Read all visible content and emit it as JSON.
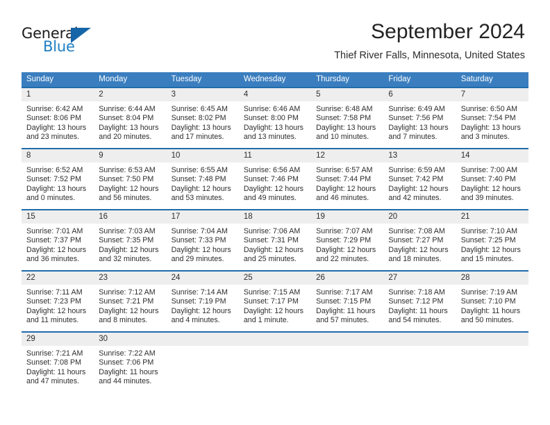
{
  "logo": {
    "text_general": "General",
    "text_blue": "Blue",
    "triangle_color": "#1565a8",
    "blue_color": "#1f7fc4"
  },
  "header": {
    "month_title": "September 2024",
    "location": "Thief River Falls, Minnesota, United States"
  },
  "theme": {
    "header_row_bg": "#3a7ebf",
    "week_separator": "#1f6cab",
    "day_band_bg": "#eeeeee",
    "text": "#2d2d2d"
  },
  "weekdays": [
    "Sunday",
    "Monday",
    "Tuesday",
    "Wednesday",
    "Thursday",
    "Friday",
    "Saturday"
  ],
  "weeks": [
    [
      {
        "day": "1",
        "sunrise": "Sunrise: 6:42 AM",
        "sunset": "Sunset: 8:06 PM",
        "daylight_line1": "Daylight: 13 hours",
        "daylight_line2": "and 23 minutes."
      },
      {
        "day": "2",
        "sunrise": "Sunrise: 6:44 AM",
        "sunset": "Sunset: 8:04 PM",
        "daylight_line1": "Daylight: 13 hours",
        "daylight_line2": "and 20 minutes."
      },
      {
        "day": "3",
        "sunrise": "Sunrise: 6:45 AM",
        "sunset": "Sunset: 8:02 PM",
        "daylight_line1": "Daylight: 13 hours",
        "daylight_line2": "and 17 minutes."
      },
      {
        "day": "4",
        "sunrise": "Sunrise: 6:46 AM",
        "sunset": "Sunset: 8:00 PM",
        "daylight_line1": "Daylight: 13 hours",
        "daylight_line2": "and 13 minutes."
      },
      {
        "day": "5",
        "sunrise": "Sunrise: 6:48 AM",
        "sunset": "Sunset: 7:58 PM",
        "daylight_line1": "Daylight: 13 hours",
        "daylight_line2": "and 10 minutes."
      },
      {
        "day": "6",
        "sunrise": "Sunrise: 6:49 AM",
        "sunset": "Sunset: 7:56 PM",
        "daylight_line1": "Daylight: 13 hours",
        "daylight_line2": "and 7 minutes."
      },
      {
        "day": "7",
        "sunrise": "Sunrise: 6:50 AM",
        "sunset": "Sunset: 7:54 PM",
        "daylight_line1": "Daylight: 13 hours",
        "daylight_line2": "and 3 minutes."
      }
    ],
    [
      {
        "day": "8",
        "sunrise": "Sunrise: 6:52 AM",
        "sunset": "Sunset: 7:52 PM",
        "daylight_line1": "Daylight: 13 hours",
        "daylight_line2": "and 0 minutes."
      },
      {
        "day": "9",
        "sunrise": "Sunrise: 6:53 AM",
        "sunset": "Sunset: 7:50 PM",
        "daylight_line1": "Daylight: 12 hours",
        "daylight_line2": "and 56 minutes."
      },
      {
        "day": "10",
        "sunrise": "Sunrise: 6:55 AM",
        "sunset": "Sunset: 7:48 PM",
        "daylight_line1": "Daylight: 12 hours",
        "daylight_line2": "and 53 minutes."
      },
      {
        "day": "11",
        "sunrise": "Sunrise: 6:56 AM",
        "sunset": "Sunset: 7:46 PM",
        "daylight_line1": "Daylight: 12 hours",
        "daylight_line2": "and 49 minutes."
      },
      {
        "day": "12",
        "sunrise": "Sunrise: 6:57 AM",
        "sunset": "Sunset: 7:44 PM",
        "daylight_line1": "Daylight: 12 hours",
        "daylight_line2": "and 46 minutes."
      },
      {
        "day": "13",
        "sunrise": "Sunrise: 6:59 AM",
        "sunset": "Sunset: 7:42 PM",
        "daylight_line1": "Daylight: 12 hours",
        "daylight_line2": "and 42 minutes."
      },
      {
        "day": "14",
        "sunrise": "Sunrise: 7:00 AM",
        "sunset": "Sunset: 7:40 PM",
        "daylight_line1": "Daylight: 12 hours",
        "daylight_line2": "and 39 minutes."
      }
    ],
    [
      {
        "day": "15",
        "sunrise": "Sunrise: 7:01 AM",
        "sunset": "Sunset: 7:37 PM",
        "daylight_line1": "Daylight: 12 hours",
        "daylight_line2": "and 36 minutes."
      },
      {
        "day": "16",
        "sunrise": "Sunrise: 7:03 AM",
        "sunset": "Sunset: 7:35 PM",
        "daylight_line1": "Daylight: 12 hours",
        "daylight_line2": "and 32 minutes."
      },
      {
        "day": "17",
        "sunrise": "Sunrise: 7:04 AM",
        "sunset": "Sunset: 7:33 PM",
        "daylight_line1": "Daylight: 12 hours",
        "daylight_line2": "and 29 minutes."
      },
      {
        "day": "18",
        "sunrise": "Sunrise: 7:06 AM",
        "sunset": "Sunset: 7:31 PM",
        "daylight_line1": "Daylight: 12 hours",
        "daylight_line2": "and 25 minutes."
      },
      {
        "day": "19",
        "sunrise": "Sunrise: 7:07 AM",
        "sunset": "Sunset: 7:29 PM",
        "daylight_line1": "Daylight: 12 hours",
        "daylight_line2": "and 22 minutes."
      },
      {
        "day": "20",
        "sunrise": "Sunrise: 7:08 AM",
        "sunset": "Sunset: 7:27 PM",
        "daylight_line1": "Daylight: 12 hours",
        "daylight_line2": "and 18 minutes."
      },
      {
        "day": "21",
        "sunrise": "Sunrise: 7:10 AM",
        "sunset": "Sunset: 7:25 PM",
        "daylight_line1": "Daylight: 12 hours",
        "daylight_line2": "and 15 minutes."
      }
    ],
    [
      {
        "day": "22",
        "sunrise": "Sunrise: 7:11 AM",
        "sunset": "Sunset: 7:23 PM",
        "daylight_line1": "Daylight: 12 hours",
        "daylight_line2": "and 11 minutes."
      },
      {
        "day": "23",
        "sunrise": "Sunrise: 7:12 AM",
        "sunset": "Sunset: 7:21 PM",
        "daylight_line1": "Daylight: 12 hours",
        "daylight_line2": "and 8 minutes."
      },
      {
        "day": "24",
        "sunrise": "Sunrise: 7:14 AM",
        "sunset": "Sunset: 7:19 PM",
        "daylight_line1": "Daylight: 12 hours",
        "daylight_line2": "and 4 minutes."
      },
      {
        "day": "25",
        "sunrise": "Sunrise: 7:15 AM",
        "sunset": "Sunset: 7:17 PM",
        "daylight_line1": "Daylight: 12 hours",
        "daylight_line2": "and 1 minute."
      },
      {
        "day": "26",
        "sunrise": "Sunrise: 7:17 AM",
        "sunset": "Sunset: 7:15 PM",
        "daylight_line1": "Daylight: 11 hours",
        "daylight_line2": "and 57 minutes."
      },
      {
        "day": "27",
        "sunrise": "Sunrise: 7:18 AM",
        "sunset": "Sunset: 7:12 PM",
        "daylight_line1": "Daylight: 11 hours",
        "daylight_line2": "and 54 minutes."
      },
      {
        "day": "28",
        "sunrise": "Sunrise: 7:19 AM",
        "sunset": "Sunset: 7:10 PM",
        "daylight_line1": "Daylight: 11 hours",
        "daylight_line2": "and 50 minutes."
      }
    ],
    [
      {
        "day": "29",
        "sunrise": "Sunrise: 7:21 AM",
        "sunset": "Sunset: 7:08 PM",
        "daylight_line1": "Daylight: 11 hours",
        "daylight_line2": "and 47 minutes."
      },
      {
        "day": "30",
        "sunrise": "Sunrise: 7:22 AM",
        "sunset": "Sunset: 7:06 PM",
        "daylight_line1": "Daylight: 11 hours",
        "daylight_line2": "and 44 minutes."
      },
      {
        "day": "",
        "sunrise": "",
        "sunset": "",
        "daylight_line1": "",
        "daylight_line2": ""
      },
      {
        "day": "",
        "sunrise": "",
        "sunset": "",
        "daylight_line1": "",
        "daylight_line2": ""
      },
      {
        "day": "",
        "sunrise": "",
        "sunset": "",
        "daylight_line1": "",
        "daylight_line2": ""
      },
      {
        "day": "",
        "sunrise": "",
        "sunset": "",
        "daylight_line1": "",
        "daylight_line2": ""
      },
      {
        "day": "",
        "sunrise": "",
        "sunset": "",
        "daylight_line1": "",
        "daylight_line2": ""
      }
    ]
  ]
}
